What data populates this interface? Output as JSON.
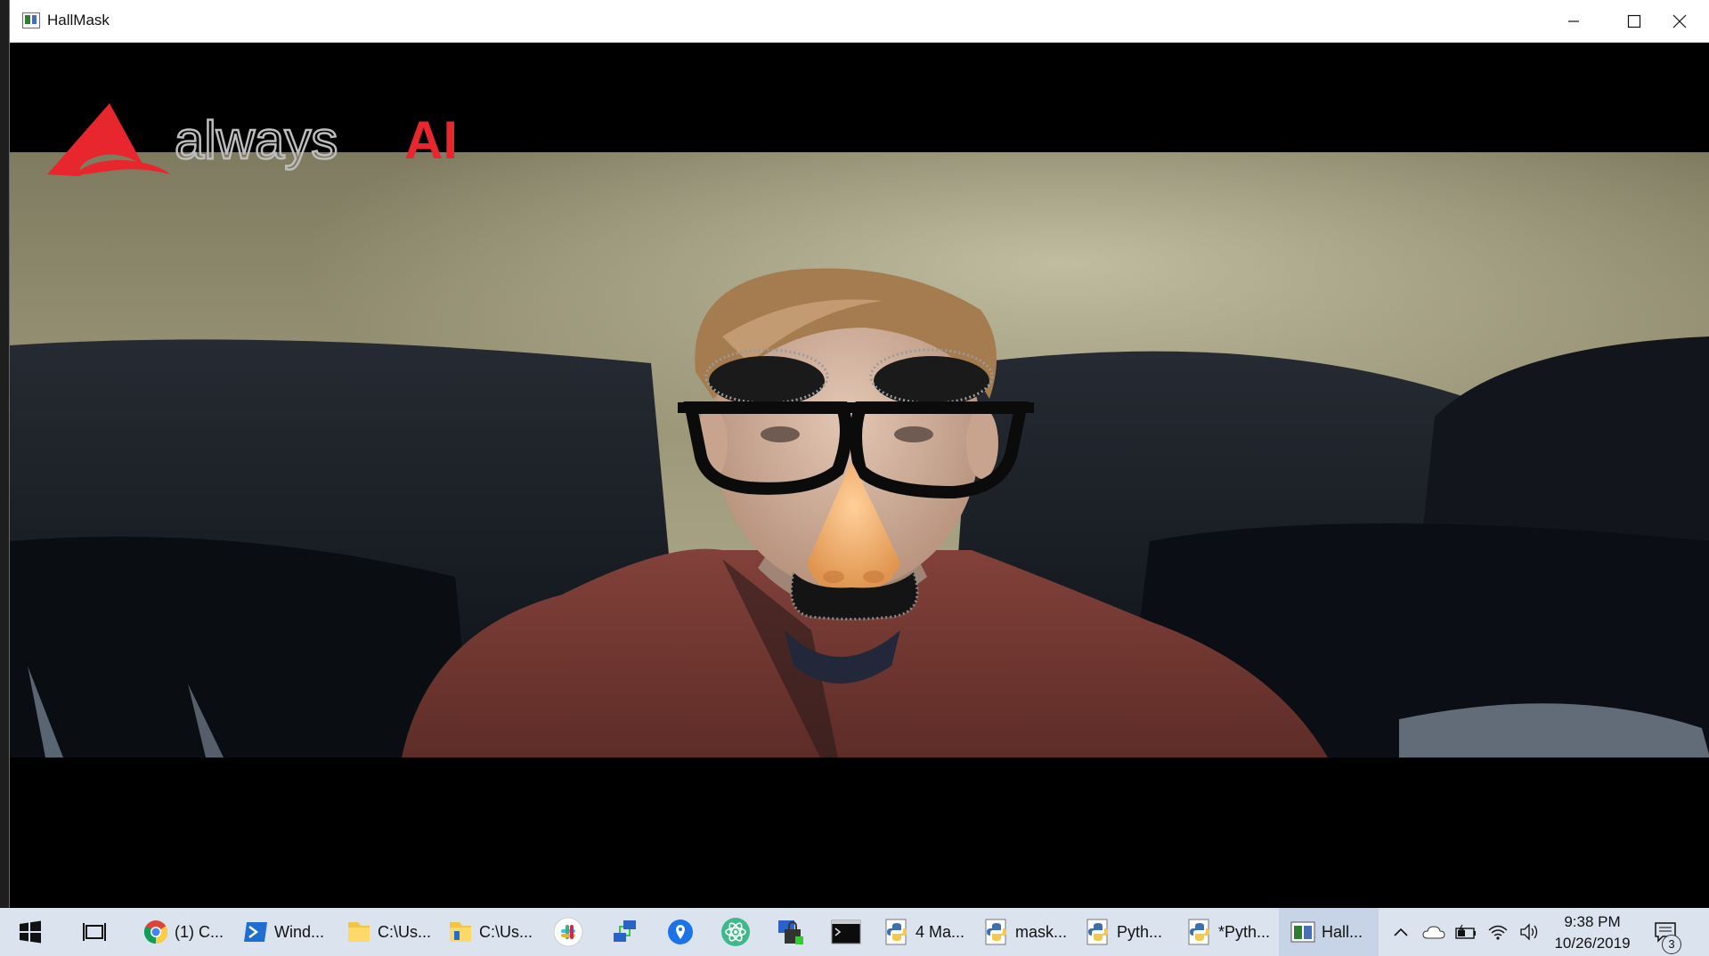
{
  "window": {
    "title": "HallMask"
  },
  "video": {
    "overlay_logo": {
      "prefix": "always",
      "suffix": "AI"
    }
  },
  "taskbar": {
    "items": [
      {
        "label": "(1) C...",
        "icon": "chrome-icon"
      },
      {
        "label": "Wind...",
        "icon": "powershell-icon"
      },
      {
        "label": "C:\\Us...",
        "icon": "folder-icon"
      },
      {
        "label": "C:\\Us...",
        "icon": "folder-icon"
      },
      {
        "label": "",
        "icon": "slack-icon"
      },
      {
        "label": "",
        "icon": "network-icon"
      },
      {
        "label": "",
        "icon": "maps-icon"
      },
      {
        "label": "",
        "icon": "atom-icon"
      },
      {
        "label": "",
        "icon": "security-icon"
      },
      {
        "label": "",
        "icon": "terminal-icon"
      },
      {
        "label": "4 Ma...",
        "icon": "python-icon"
      },
      {
        "label": "mask...",
        "icon": "python-icon"
      },
      {
        "label": "Pyth...",
        "icon": "python-icon"
      },
      {
        "label": "*Pyth...",
        "icon": "python-icon"
      },
      {
        "label": "Hall...",
        "icon": "hallmask-icon"
      }
    ],
    "clock": {
      "time": "9:38 PM",
      "date": "10/26/2019"
    },
    "notification_count": "3"
  },
  "colors": {
    "logo_red": "#e8262d",
    "logo_grey": "#bdbdbd",
    "taskbar_bg": "#dbe3ef",
    "wall": "#9a9476",
    "couch": "#161a20",
    "sweater": "#7a3a33"
  }
}
